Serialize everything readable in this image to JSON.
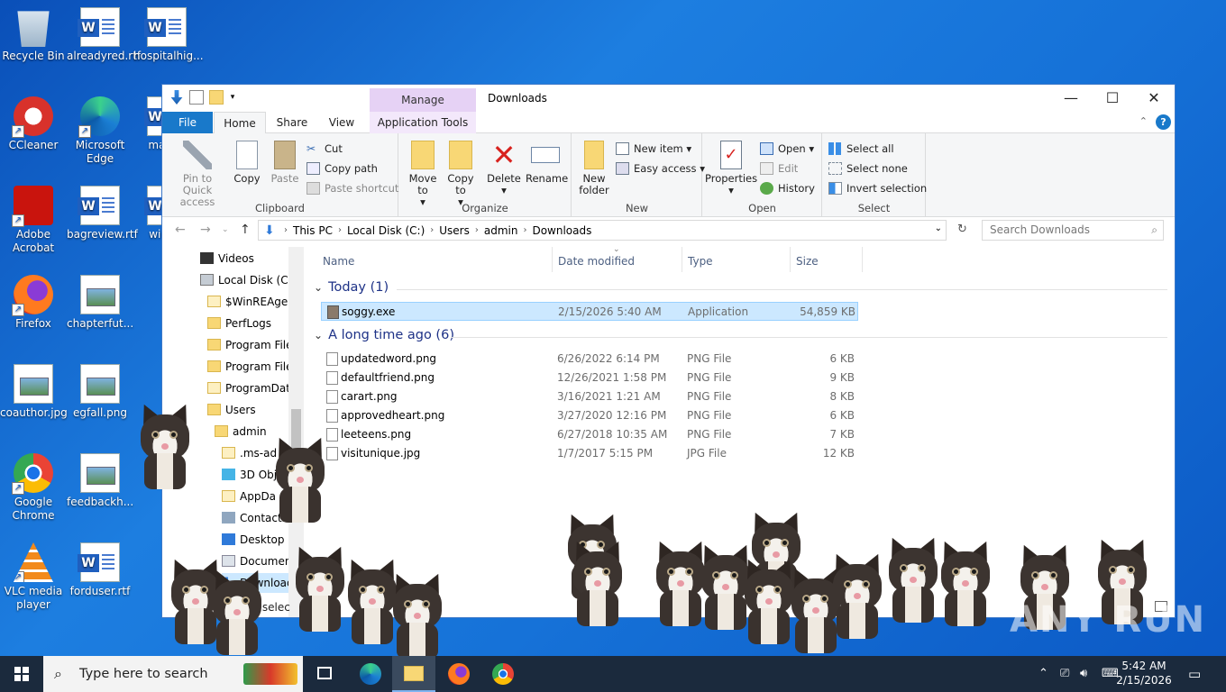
{
  "desktop": {
    "icons": [
      {
        "label": "Recycle Bin"
      },
      {
        "label": "alreadyred.rtf"
      },
      {
        "label": "hospitalhig..."
      },
      {
        "label": "CCleaner"
      },
      {
        "label": "Microsoft Edge"
      },
      {
        "label": "male..."
      },
      {
        "label": "Adobe Acrobat"
      },
      {
        "label": "bagreview.rtf"
      },
      {
        "label": "wine..."
      },
      {
        "label": "Firefox"
      },
      {
        "label": "chapterfut..."
      },
      {
        "label": "coauthor.jpg"
      },
      {
        "label": "egfall.png"
      },
      {
        "label": "Google Chrome"
      },
      {
        "label": "feedbackh..."
      },
      {
        "label": "VLC media player"
      },
      {
        "label": "forduser.rtf"
      }
    ]
  },
  "window": {
    "title": "Downloads",
    "manage_tab": "Manage",
    "tabs": {
      "file": "File",
      "home": "Home",
      "share": "Share",
      "view": "View",
      "app_tools": "Application Tools"
    },
    "ribbon": {
      "clipboard": {
        "label": "Clipboard",
        "pin": "Pin to Quick access",
        "copy": "Copy",
        "paste": "Paste",
        "cut": "Cut",
        "copy_path": "Copy path",
        "paste_shortcut": "Paste shortcut"
      },
      "organize": {
        "label": "Organize",
        "move_to": "Move to",
        "copy_to": "Copy to",
        "delete": "Delete",
        "rename": "Rename"
      },
      "new": {
        "label": "New",
        "new_folder": "New folder",
        "new_item": "New item",
        "easy_access": "Easy access"
      },
      "open": {
        "label": "Open",
        "properties": "Properties",
        "open": "Open",
        "edit": "Edit",
        "history": "History"
      },
      "select": {
        "label": "Select",
        "select_all": "Select all",
        "select_none": "Select none",
        "invert": "Invert selection"
      }
    },
    "address": {
      "crumbs": [
        "This PC",
        "Local Disk (C:)",
        "Users",
        "admin",
        "Downloads"
      ],
      "search_placeholder": "Search Downloads"
    },
    "nav": [
      {
        "label": "Videos"
      },
      {
        "label": "Local Disk (C:)"
      },
      {
        "label": "$WinREAgent"
      },
      {
        "label": "PerfLogs"
      },
      {
        "label": "Program Files"
      },
      {
        "label": "Program Files"
      },
      {
        "label": "ProgramData"
      },
      {
        "label": "Users"
      },
      {
        "label": "admin"
      },
      {
        "label": ".ms-ad"
      },
      {
        "label": "3D Obje"
      },
      {
        "label": "AppDa"
      },
      {
        "label": "Contacts"
      },
      {
        "label": "Desktop"
      },
      {
        "label": "Documen"
      },
      {
        "label": "Download"
      }
    ],
    "columns": {
      "name": "Name",
      "date": "Date modified",
      "type": "Type",
      "size": "Size"
    },
    "groups": {
      "today": "Today (1)",
      "long_ago": "A long time ago (6)"
    },
    "files_today": [
      {
        "name": "soggy.exe",
        "date": "2/15/2026 5:40 AM",
        "type": "Application",
        "size": "54,859 KB"
      }
    ],
    "files_old": [
      {
        "name": "updatedword.png",
        "date": "6/26/2022 6:14 PM",
        "type": "PNG File",
        "size": "6 KB"
      },
      {
        "name": "defaultfriend.png",
        "date": "12/26/2021 1:58 PM",
        "type": "PNG File",
        "size": "9 KB"
      },
      {
        "name": "carart.png",
        "date": "3/16/2021 1:21 AM",
        "type": "PNG File",
        "size": "8 KB"
      },
      {
        "name": "approvedheart.png",
        "date": "3/27/2020 12:16 PM",
        "type": "PNG File",
        "size": "6 KB"
      },
      {
        "name": "leeteens.png",
        "date": "6/27/2018 10:35 AM",
        "type": "PNG File",
        "size": "7 KB"
      },
      {
        "name": "visitunique.jpg",
        "date": "1/7/2017 5:15 PM",
        "type": "JPG File",
        "size": "12 KB"
      }
    ],
    "status": "item selec"
  },
  "watermark": "ANY RUN",
  "taskbar": {
    "search_placeholder": "Type here to search",
    "time": "5:42 AM",
    "date": "2/15/2026"
  }
}
